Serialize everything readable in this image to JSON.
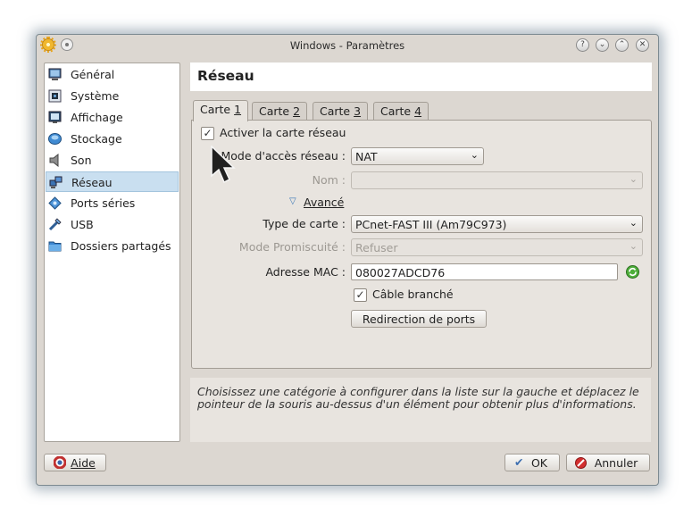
{
  "window": {
    "title": "Windows - Paramètres"
  },
  "window_buttons": [
    "?",
    "⌄",
    "⌃",
    "✕"
  ],
  "sidebar": {
    "items": [
      {
        "label": "Général",
        "icon": "monitor-icon",
        "selected": false
      },
      {
        "label": "Système",
        "icon": "chip-icon",
        "selected": false
      },
      {
        "label": "Affichage",
        "icon": "display-icon",
        "selected": false
      },
      {
        "label": "Stockage",
        "icon": "disk-icon",
        "selected": false
      },
      {
        "label": "Son",
        "icon": "speaker-icon",
        "selected": false
      },
      {
        "label": "Réseau",
        "icon": "network-icon",
        "selected": true
      },
      {
        "label": "Ports séries",
        "icon": "serial-port-icon",
        "selected": false
      },
      {
        "label": "USB",
        "icon": "usb-icon",
        "selected": false
      },
      {
        "label": "Dossiers partagés",
        "icon": "folder-icon",
        "selected": false
      }
    ]
  },
  "main": {
    "heading": "Réseau",
    "tabs": [
      {
        "label": "Carte ",
        "key": "1",
        "active": true
      },
      {
        "label": "Carte ",
        "key": "2",
        "active": false
      },
      {
        "label": "Carte ",
        "key": "3",
        "active": false
      },
      {
        "label": "Carte ",
        "key": "4",
        "active": false
      }
    ],
    "enable_checkbox": {
      "label": "Activer la carte réseau",
      "checked": true
    },
    "access_mode": {
      "label": "Mode d'accès réseau :",
      "value": "NAT"
    },
    "name": {
      "label": "Nom :",
      "value": ""
    },
    "advanced": {
      "label": "Avancé"
    },
    "adapter_type": {
      "label": "Type de carte :",
      "value": "PCnet-FAST III (Am79C973)"
    },
    "promiscuous_mode": {
      "label": "Mode Promiscuité :",
      "value": "Refuser"
    },
    "mac_address": {
      "label": "Adresse MAC :",
      "value": "080027ADCD76"
    },
    "cable_checkbox": {
      "label": "Câble branché",
      "checked": true
    },
    "port_forwarding_button": {
      "label": "Redirection de ports"
    }
  },
  "info_text": "Choisissez une catégorie à configurer dans la liste sur la gauche et déplacez le pointeur de la souris au-dessus d'un élément pour obtenir plus d'informations.",
  "footer": {
    "help_label": "Aide",
    "ok_label": "OK",
    "cancel_label": "Annuler"
  }
}
